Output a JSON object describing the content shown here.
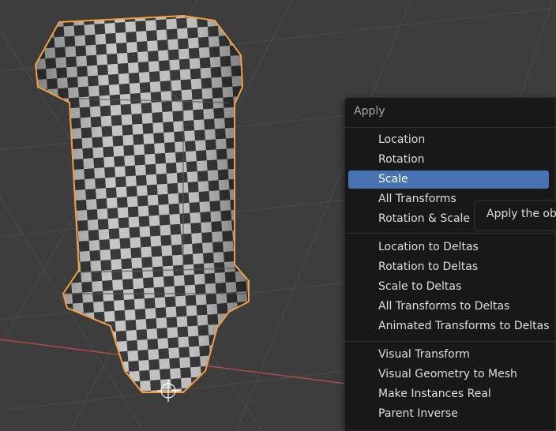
{
  "menu": {
    "title": "Apply",
    "items": [
      {
        "label": "Location",
        "active": false
      },
      {
        "label": "Rotation",
        "active": false
      },
      {
        "label": "Scale",
        "active": true
      },
      {
        "label": "All Transforms",
        "active": false
      },
      {
        "label": "Rotation & Scale",
        "active": false
      },
      {
        "label": "Location to Deltas",
        "active": false
      },
      {
        "label": "Rotation to Deltas",
        "active": false
      },
      {
        "label": "Scale to Deltas",
        "active": false
      },
      {
        "label": "All Transforms to Deltas",
        "active": false
      },
      {
        "label": "Animated Transforms to Deltas",
        "active": false
      },
      {
        "label": "Visual Transform",
        "active": false
      },
      {
        "label": "Visual Geometry to Mesh",
        "active": false
      },
      {
        "label": "Make Instances Real",
        "active": false
      },
      {
        "label": "Parent Inverse",
        "active": false
      }
    ]
  },
  "tooltip": {
    "text": "Apply the obje"
  },
  "colors": {
    "background": "#3d3d3d",
    "grid_line": "#4a4a4a",
    "x_axis": "#b34a4a",
    "selection_outline": "#f0a040",
    "menu_bg": "#181818",
    "menu_highlight": "#4772b3",
    "checker_dark": "#3a3a3a",
    "checker_light": "#c8c8c8"
  }
}
